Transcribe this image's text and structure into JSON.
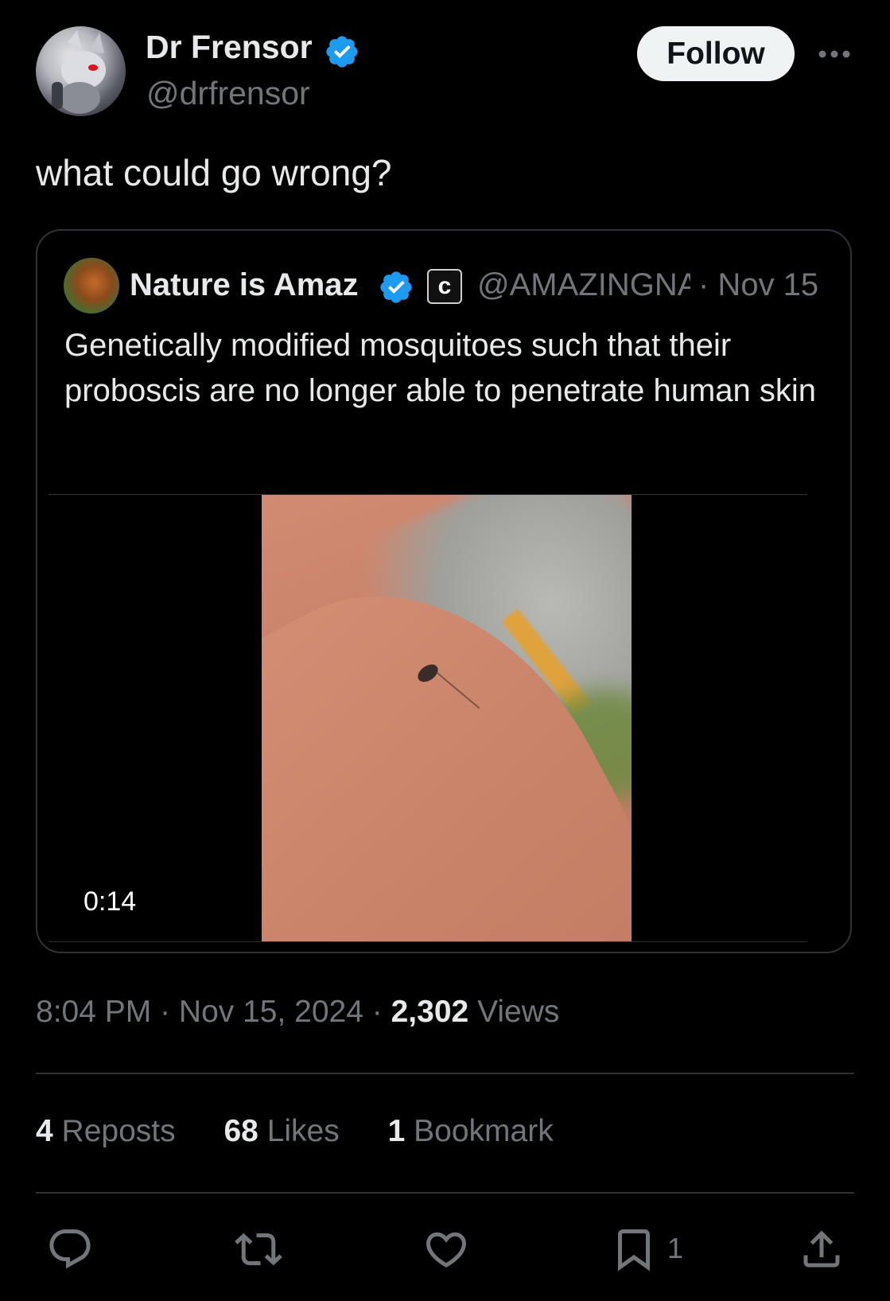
{
  "tweet": {
    "author_name": "Dr Frensor",
    "author_handle": "@drfrensor",
    "follow_label": "Follow",
    "text": "what could go wrong?",
    "time": "8:04 PM",
    "date": "Nov 15, 2024",
    "views_count": "2,302",
    "views_label": "Views"
  },
  "quote": {
    "author_name": "Nature is Amaz",
    "badge_letter": "c",
    "author_handle": "@AMAZINGNATURE",
    "date": "· Nov 15",
    "text": "Genetically modified mosquitoes such that their proboscis are no longer able to penetrate human skin",
    "video_duration": "0:14"
  },
  "stats": {
    "reposts_count": "4",
    "reposts_label": "Reposts",
    "likes_count": "68",
    "likes_label": "Likes",
    "bookmarks_count": "1",
    "bookmarks_label": "Bookmark"
  },
  "actions": {
    "bookmark_count": "1"
  },
  "colors": {
    "background": "#000000",
    "text_primary": "#e7e9ea",
    "text_secondary": "#71767b",
    "verified_blue": "#1d9bf0",
    "divider": "#2f3336"
  }
}
